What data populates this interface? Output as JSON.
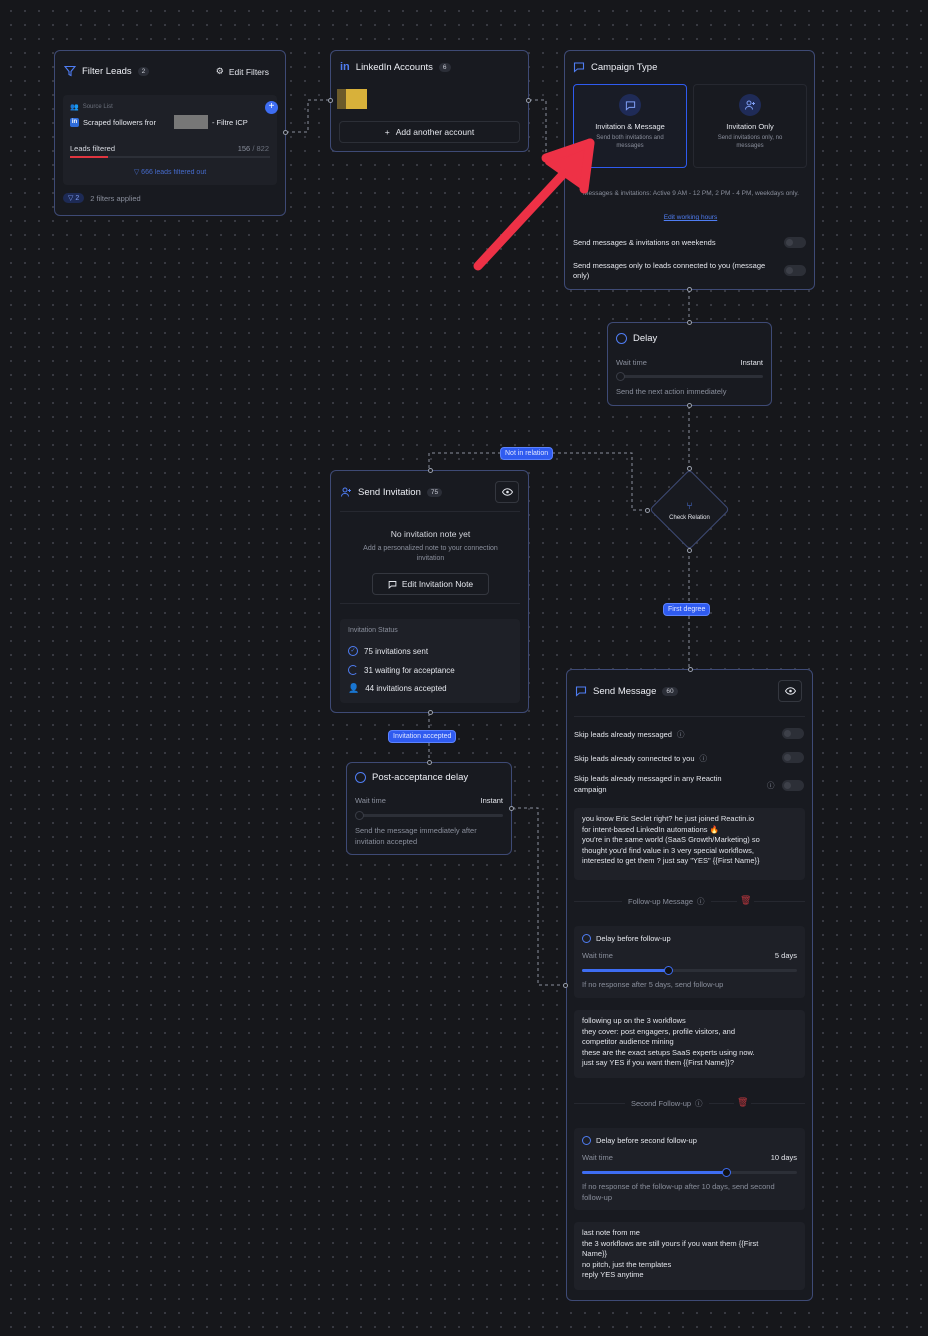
{
  "filter_leads": {
    "title": "Filter Leads",
    "count": "2",
    "edit_label": "Edit Filters",
    "source_list_label": "Source List",
    "source_name": "Scraped followers fror",
    "source_suffix": "- Filtre ICP",
    "leads_filtered_label": "Leads filtered",
    "leads_filtered_value": "156",
    "leads_total": "/ 822",
    "leads_progress": 0.19,
    "filtered_out": "666 leads filtered out",
    "filters_badge": "2",
    "filters_applied": "2 filters applied"
  },
  "linkedin_accounts": {
    "title": "LinkedIn Accounts",
    "count": "6",
    "add_label": "Add another account"
  },
  "campaign_type": {
    "title": "Campaign Type",
    "options": [
      {
        "title": "Invitation & Message",
        "desc": "Send both invitations and messages",
        "selected": true
      },
      {
        "title": "Invitation Only",
        "desc": "Send invitations only, no messages",
        "selected": false
      }
    ],
    "schedule_text": "Messages & invitations: Active 9 AM - 12 PM, 2 PM - 4 PM, weekdays only.",
    "edit_hours": "Edit working hours",
    "weekend_label": "Send messages & invitations on weekends",
    "connected_only_label": "Send messages only to leads connected to you (message only)"
  },
  "delay": {
    "title": "Delay",
    "wait_label": "Wait time",
    "wait_value": "Instant",
    "wait_level": 0,
    "desc": "Send the next action immediately"
  },
  "check_relation": {
    "label": "Check Relation",
    "not_in_relation": "Not in relation",
    "first_degree": "First degree"
  },
  "send_invitation": {
    "title": "Send Invitation",
    "count": "75",
    "empty_title": "No invitation note yet",
    "empty_desc": "Add a personalized note to your connection invitation",
    "edit_label": "Edit Invitation Note",
    "status_title": "Invitation Status",
    "sent": "75 invitations sent",
    "waiting": "31 waiting for acceptance",
    "accepted": "44 invitations accepted",
    "accepted_pill": "Invitation accepted"
  },
  "post_acceptance": {
    "title": "Post-acceptance delay",
    "wait_label": "Wait time",
    "wait_value": "Instant",
    "wait_level": 0,
    "desc": "Send the message immediately after invitation accepted"
  },
  "send_message": {
    "title": "Send Message",
    "count": "60",
    "skip_messaged": "Skip leads already messaged",
    "skip_connected": "Skip leads already connected to you",
    "skip_any": "Skip leads already messaged in any Reactin campaign",
    "message1": "you know Eric Seclet right? he just joined Reactin.io\nfor intent-based LinkedIn automations 🔥\nyou're in the same world (SaaS Growth/Marketing) so\nthought you'd find value in 3 very special workflows,\ninterested to get them ? just say \"YES\" {{First Name}}",
    "followup_label": "Follow-up Message",
    "delay1_title": "Delay before follow-up",
    "delay1_wait_label": "Wait time",
    "delay1_value": "5 days",
    "delay1_level": 0.4,
    "delay1_desc": "If no response after 5 days, send follow-up",
    "message2": "following up on the 3 workflows\nthey cover: post engagers, profile visitors, and\ncompetitor audience mining\nthese are the exact setups SaaS experts using now.\njust say YES if you want them {{First Name}}?",
    "second_followup_label": "Second Follow-up",
    "delay2_title": "Delay before second follow-up",
    "delay2_wait_label": "Wait time",
    "delay2_value": "10 days",
    "delay2_level": 0.67,
    "delay2_desc": "If no response of the follow-up after 10 days, send second follow-up",
    "message3": "last note from me\nthe 3 workflows are still yours if you want them {{First\nName}}\nno pitch, just the templates\nreply YES anytime"
  },
  "colors": {
    "accent": "#3e6df2",
    "card_border": "#3e4a75",
    "arrow": "#ee3146",
    "background": "#16171b"
  }
}
